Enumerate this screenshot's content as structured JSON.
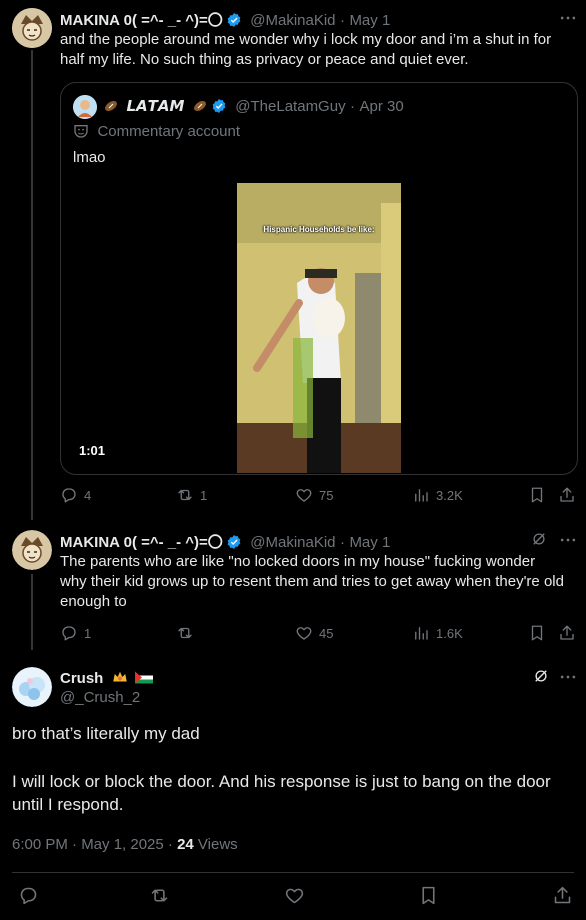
{
  "tweet1": {
    "name": "MAKINA 0( =^- _- ^)=〇",
    "handle": "@MakinaKid",
    "date": "May 1",
    "text": "and the people around me wonder why i lock my door and i’m a shut in for half my life. No such thing as privacy or peace and quiet ever.",
    "replies": "4",
    "reposts": "1",
    "likes": "75",
    "views": "3.2K"
  },
  "quote": {
    "name": "𝙇𝘼𝙏𝘼𝙈",
    "handle": "@TheLatamGuy",
    "date": "Apr 30",
    "label": "Commentary account",
    "text": "lmao",
    "video_caption": "Hispanic Households be like:",
    "video_duration": "1:01"
  },
  "tweet2": {
    "name": "MAKINA 0( =^- _- ^)=〇",
    "handle": "@MakinaKid",
    "date": "May 1",
    "text": "The parents who are like \"no locked doors in my house\" fucking wonder why their kid grows up to resent them and tries to get away when they're old enough to",
    "replies": "1",
    "reposts": "",
    "likes": "45",
    "views": "1.6K"
  },
  "main": {
    "name": "Crush",
    "handle": "@_Crush_2",
    "text_line1": "bro that’s literally my dad",
    "text_line2": "I will lock or block the door. And his response is just to bang on the door until I respond.",
    "time": "6:00 PM · May 1, 2025 · ",
    "views_count": "24",
    "views_label": " Views"
  },
  "colors": {
    "background": "#000000",
    "text": "#e7e9ea",
    "muted": "#71767b",
    "verified": "#1d9bf0",
    "border": "#2f3336"
  },
  "icons": [
    "reply-icon",
    "repost-icon",
    "like-icon",
    "views-icon",
    "bookmark-icon",
    "share-icon",
    "grok-icon",
    "more-icon",
    "verified-icon",
    "masks-icon",
    "football-icon"
  ]
}
